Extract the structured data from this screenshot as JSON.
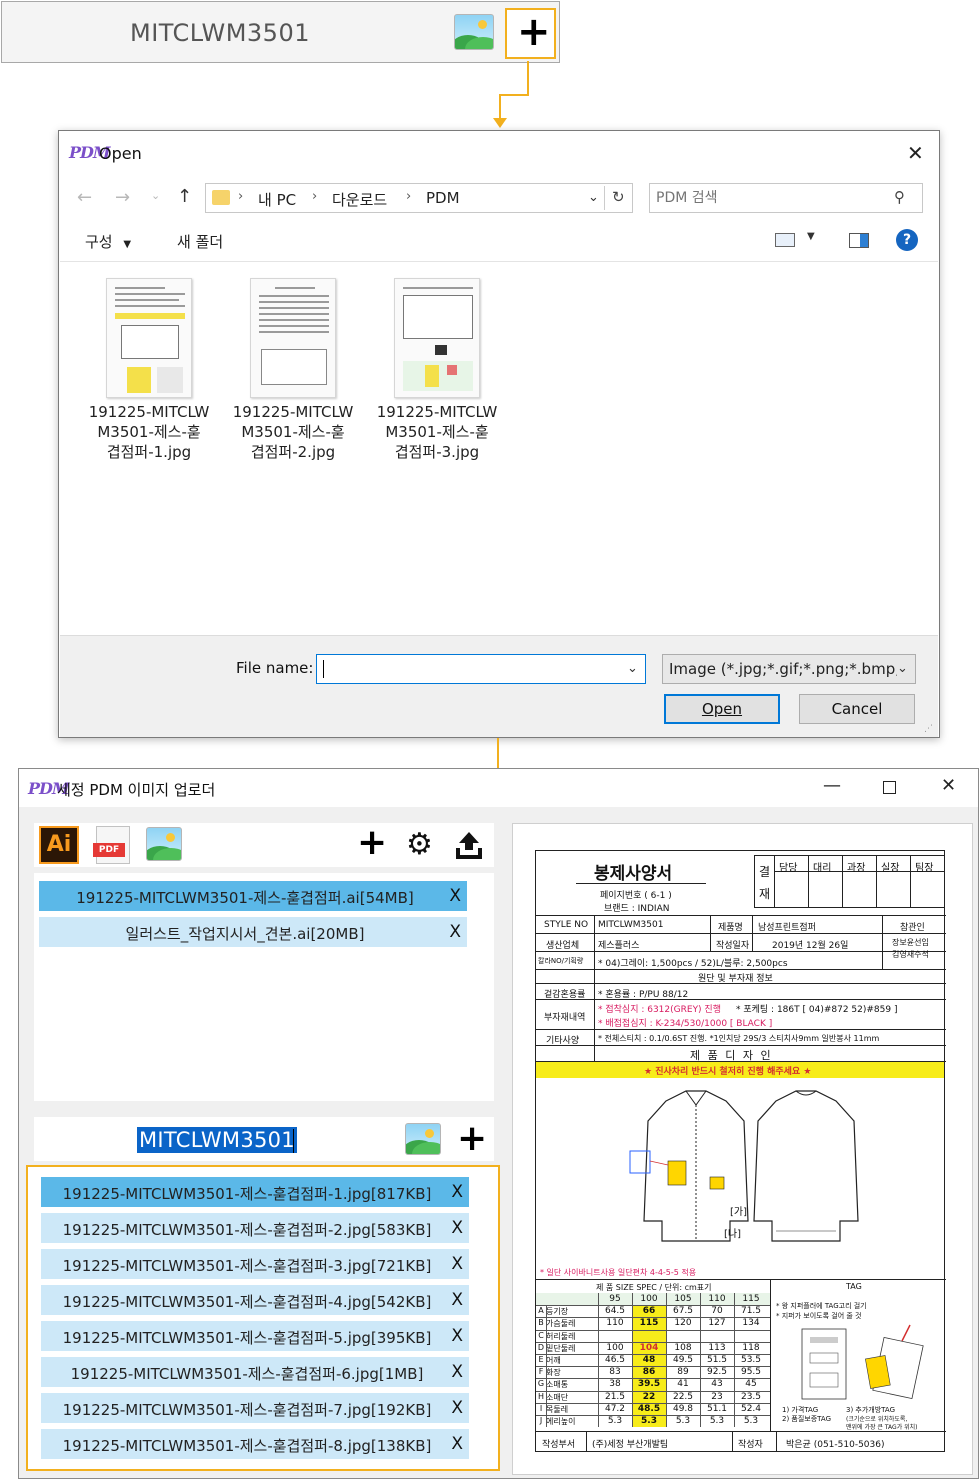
{
  "top_strip": {
    "product_code": "MITCLWM3501"
  },
  "dialog": {
    "logo": "PDM",
    "title": "Open",
    "breadcrumb": [
      "내 PC",
      "다운로드",
      "PDM"
    ],
    "search_placeholder": "PDM 검색",
    "toolbar": {
      "organize": "구성",
      "new_folder": "새 폴더"
    },
    "files": [
      {
        "label_line1": "191225-MITCLW",
        "label_line2": "M3501-제스-훋",
        "label_line3": "겹점퍼-1.jpg"
      },
      {
        "label_line1": "191225-MITCLW",
        "label_line2": "M3501-제스-훋",
        "label_line3": "겹점퍼-2.jpg"
      },
      {
        "label_line1": "191225-MITCLW",
        "label_line2": "M3501-제스-훋",
        "label_line3": "겹점퍼-3.jpg"
      }
    ],
    "filename_label": "File name:",
    "filename_value": "",
    "filetype": "Image (*.jpg;*.gif;*.png;*.bmp;*",
    "open_label": "Open",
    "cancel_label": "Cancel"
  },
  "uploader": {
    "logo": "PDM",
    "title": "세정 PDM 이미지 업로더",
    "ai_label": "Ai",
    "pdf_label": "PDF",
    "ai_files": [
      {
        "name": "191225-MITCLWM3501-제스-훋겹점퍼.ai[54MB]",
        "remove": "X"
      },
      {
        "name": "일러스트_작업지시서_견본.ai[20MB]",
        "remove": "X"
      }
    ],
    "product_code": "MITCLWM3501",
    "image_files": [
      {
        "name": "191225-MITCLWM3501-제스-훋겹점퍼-1.jpg[817KB]",
        "remove": "X"
      },
      {
        "name": "191225-MITCLWM3501-제스-훋겹점퍼-2.jpg[583KB]",
        "remove": "X"
      },
      {
        "name": "191225-MITCLWM3501-제스-훋겹점퍼-3.jpg[721KB]",
        "remove": "X"
      },
      {
        "name": "191225-MITCLWM3501-제스-훋겹점퍼-4.jpg[542KB]",
        "remove": "X"
      },
      {
        "name": "191225-MITCLWM3501-제스-훋겹점퍼-5.jpg[395KB]",
        "remove": "X"
      },
      {
        "name": "191225-MITCLWM3501-제스-훋겹점퍼-6.jpg[1MB]",
        "remove": "X"
      },
      {
        "name": "191225-MITCLWM3501-제스-훋겹점퍼-7.jpg[192KB]",
        "remove": "X"
      },
      {
        "name": "191225-MITCLWM3501-제스-훋겹점퍼-8.jpg[138KB]",
        "remove": "X"
      }
    ]
  },
  "sheet": {
    "title": "봉제사양서",
    "page_no": "페이지번호 ( 6-1 )",
    "brand": "브랜드 : INDIAN",
    "approval_label_1": "결",
    "approval_label_2": "재",
    "approvals": [
      "담당",
      "대리",
      "과장",
      "실장",
      "팀장"
    ],
    "style_no_label": "STYLE NO",
    "style_no": "MITCLWM3501",
    "product_name_label": "제품명",
    "product_name": "남성프린트점퍼",
    "owner_label": "참관인",
    "maker_label": "생산업체",
    "maker": "제스플러스",
    "date_label": "작성일자",
    "date": "2019년 12월 26일",
    "owner_value_1": "장보윤선임",
    "owner_value_2": "김영재수석",
    "color_label": "칼라NO/기획량",
    "color_value": "* 04)그레이: 1,500pcs / 52)L/블루: 2,500pcs",
    "fabric_header": "원단 및 부자재 정보",
    "fabric_label": "겉감혼용률",
    "fabric_value": "* 혼용률 : P/PU 88/12",
    "sub_label": "부자재내역",
    "sub_value_1": "* 접착심지 : 6312(GREY) 진행",
    "sub_value_1b": "* 포케팅 : 186T [ 04)#872 52)#859 ]",
    "sub_value_2": "* 배접접심지 : K-234/530/1000 [ BLACK ]",
    "etc_label": "기타사양",
    "etc_value": "* 전체스티치 : 0.1/0.6ST 진행. *1인치당 29S/3 스티치사9mm 일반봉사 11mm",
    "design_header": "제 품 디 자 인",
    "warning": "★ 진사차리 반드시 철저히 진행 해주세요 ★",
    "callout_ga": "[가]",
    "callout_na": "[나]",
    "note_bottom": "* 일단 사이바니트사용 일단편차 4-4-5-5 적용",
    "size_header": "제 품 SIZE SPEC / 단위: cm표기",
    "tag_header": "TAG",
    "sizes": [
      "95",
      "100",
      "105",
      "110",
      "115"
    ],
    "spec_rows": [
      {
        "code": "A",
        "name": "등기장",
        "values": [
          "64.5",
          "66",
          "67.5",
          "70",
          "71.5"
        ]
      },
      {
        "code": "B",
        "name": "가슴둘레",
        "values": [
          "110",
          "115",
          "120",
          "127",
          "134"
        ]
      },
      {
        "code": "C",
        "name": "허리둘레",
        "values": [
          "",
          "",
          "",
          "",
          ""
        ]
      },
      {
        "code": "D",
        "name": "밑단둘레",
        "values": [
          "100",
          "104",
          "108",
          "113",
          "118"
        ]
      },
      {
        "code": "E",
        "name": "어깨",
        "values": [
          "46.5",
          "48",
          "49.5",
          "51.5",
          "53.5"
        ]
      },
      {
        "code": "F",
        "name": "화장",
        "values": [
          "83",
          "86",
          "89",
          "92.5",
          "95.5"
        ]
      },
      {
        "code": "G",
        "name": "소매통",
        "values": [
          "38",
          "39.5",
          "41",
          "43",
          "45"
        ]
      },
      {
        "code": "H",
        "name": "소매단",
        "values": [
          "21.5",
          "22",
          "22.5",
          "23",
          "23.5"
        ]
      },
      {
        "code": "I",
        "name": "목둘레",
        "values": [
          "47.2",
          "48.5",
          "49.8",
          "51.1",
          "52.4"
        ]
      },
      {
        "code": "J",
        "name": "에리높이",
        "values": [
          "5.3",
          "5.3",
          "5.3",
          "5.3",
          "5.3"
        ]
      }
    ],
    "tag_note_1": "* 왕 지퍼플러에 TAG고리 걸기",
    "tag_note_2": "* 지퍼가 보이도록 걸어 줄 것",
    "tag_item_1": "1) 가격TAG",
    "tag_item_2": "2) 품질보증TAG",
    "tag_item_3": "3) 추가개방TAG",
    "tag_item_3b": "(크기순으로 위치하도록,",
    "tag_item_3c": "맨위에 가장 큰 TAG가 위치)",
    "footer_label": "작성부서",
    "footer_dept": "(주)세정 부산개발팀",
    "footer_writer_label": "작성자",
    "footer_writer": "박은균 (051-510-5036)"
  }
}
